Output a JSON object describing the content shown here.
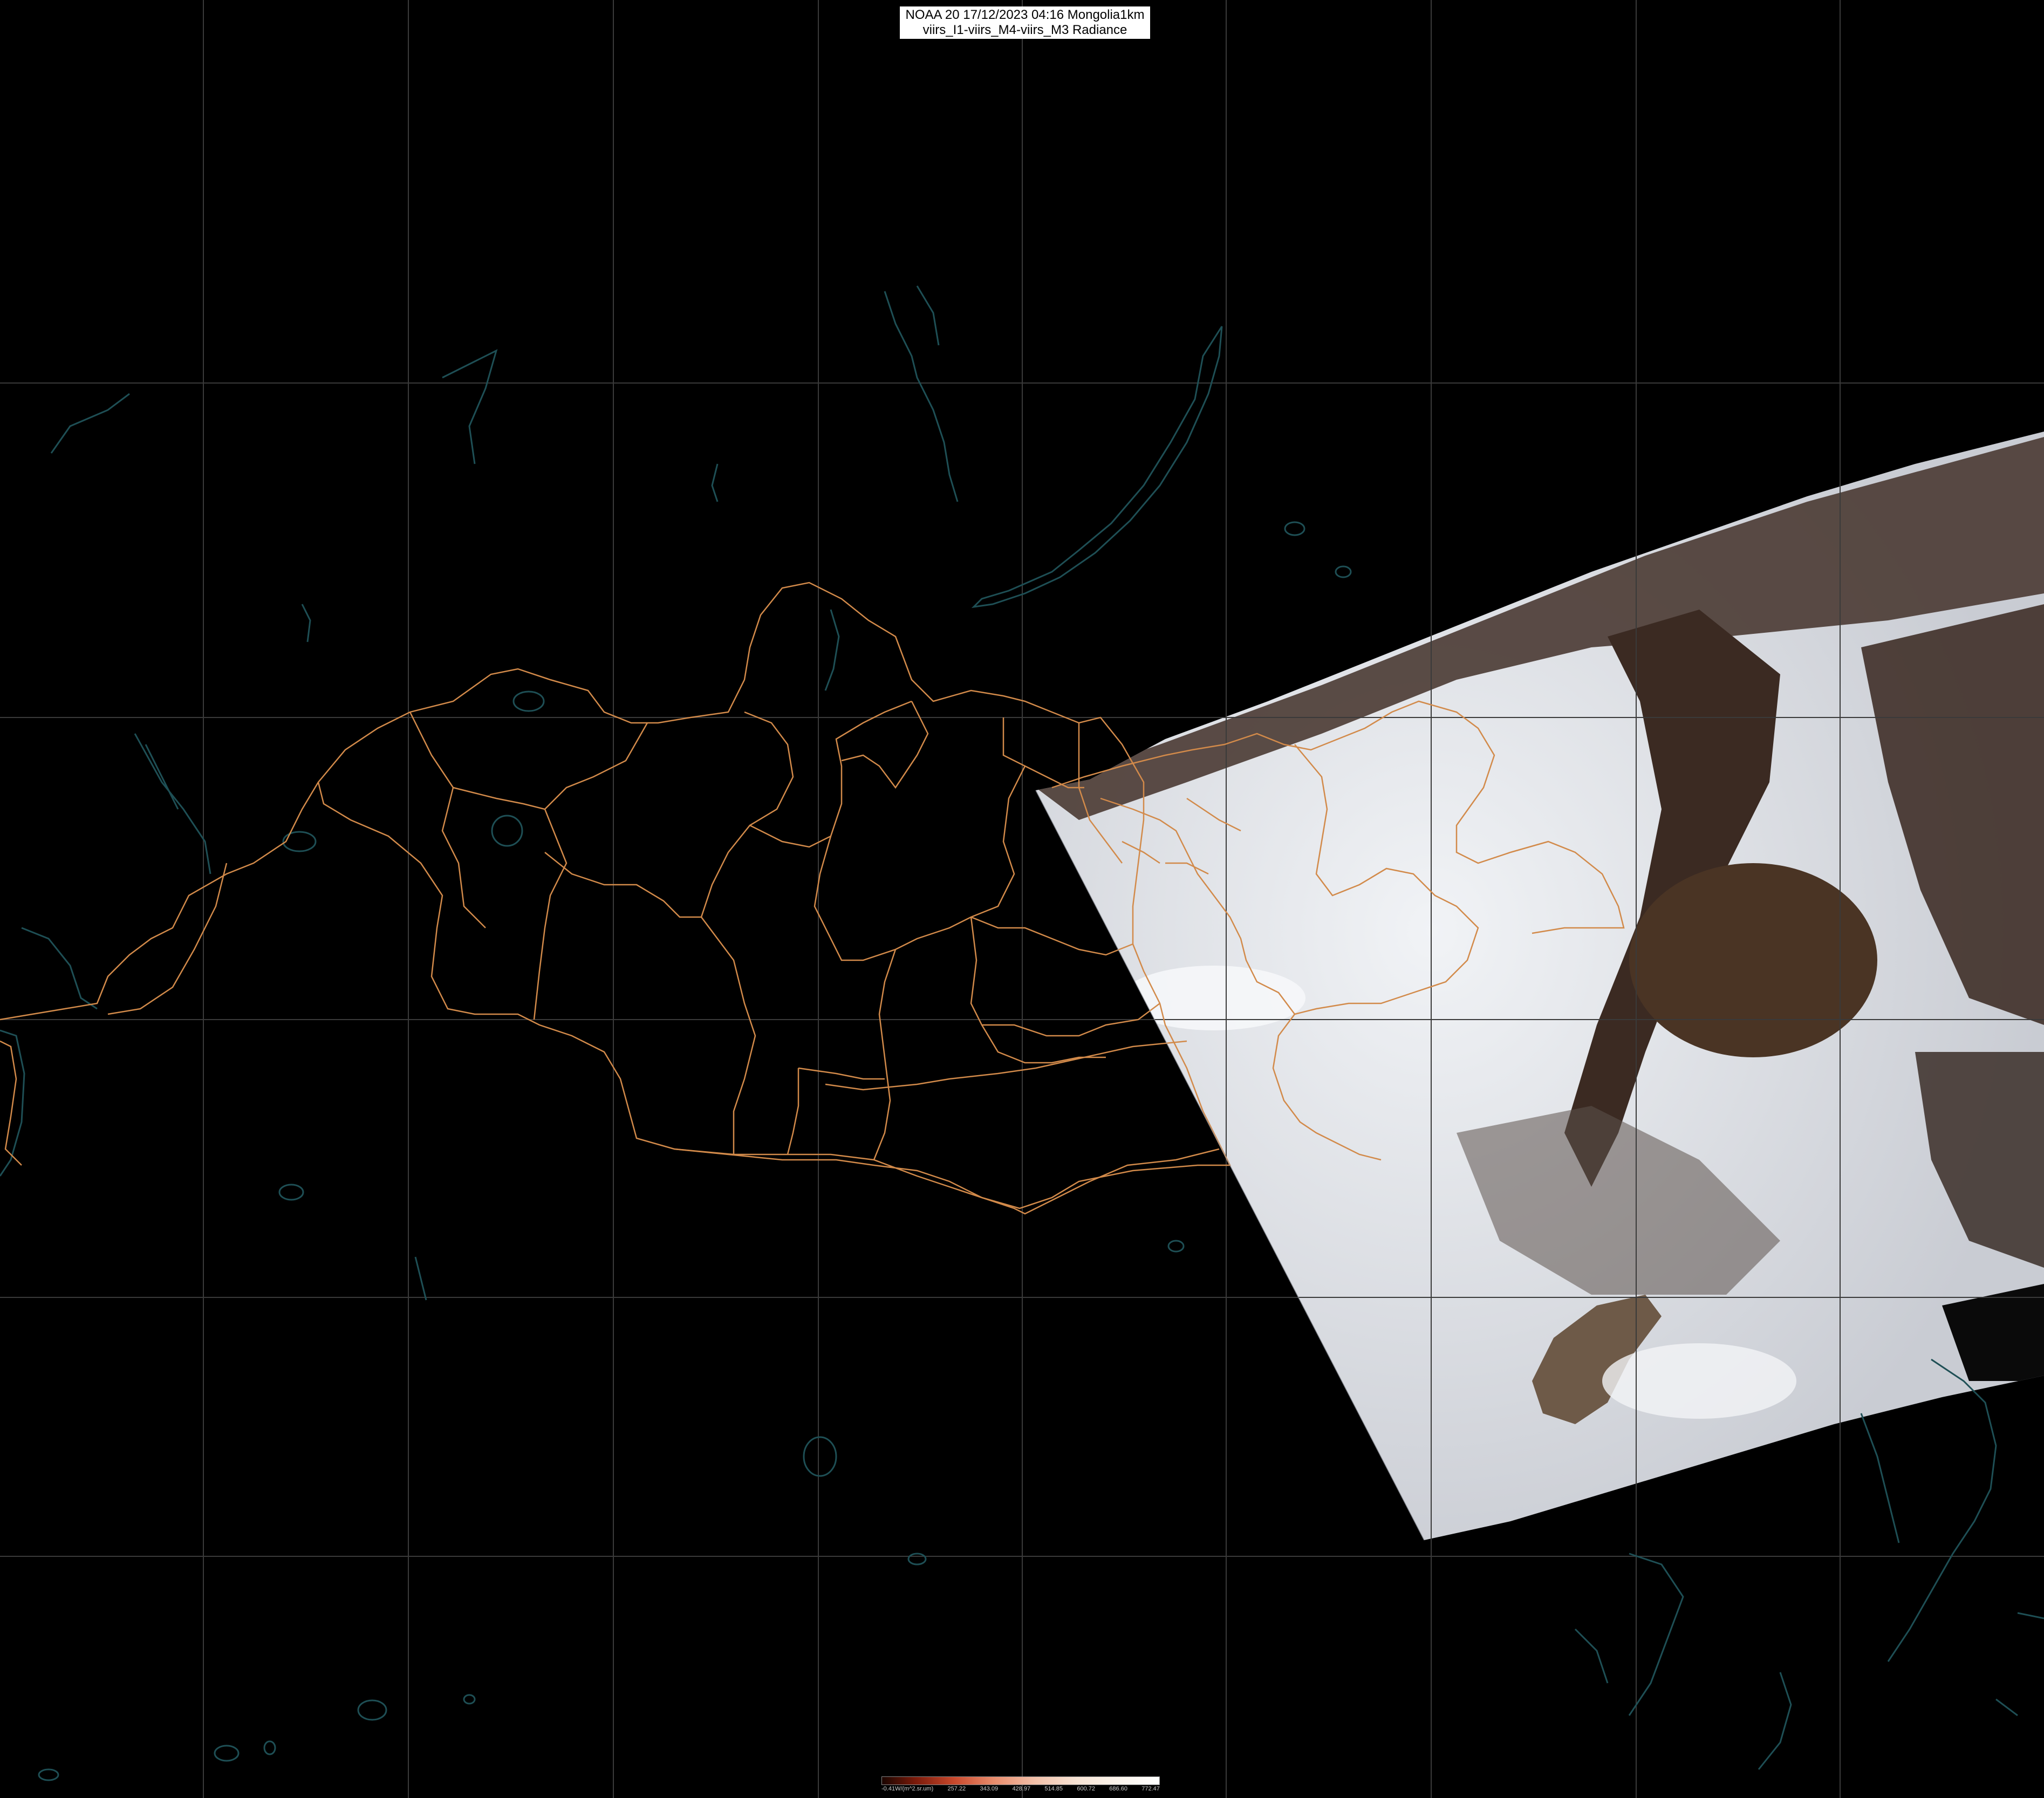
{
  "header": {
    "line1": "NOAA 20 17/12/2023 04:16 Mongolia1km",
    "line2": "viirs_I1-viirs_M4-viirs_M3 Radiance"
  },
  "colorbar": {
    "labels": [
      "-0.41W/(m^2.sr.um)",
      "257.22",
      "343.09",
      "428.97",
      "514.85",
      "600.72",
      "686.60",
      "772.47"
    ]
  },
  "colors": {
    "background": "#000000",
    "graticule": "#3a3a3a",
    "border": "#d28a4a",
    "coastline": "#1e4f55",
    "snow": "#e6e9ee",
    "forest": "#3b2a22"
  }
}
